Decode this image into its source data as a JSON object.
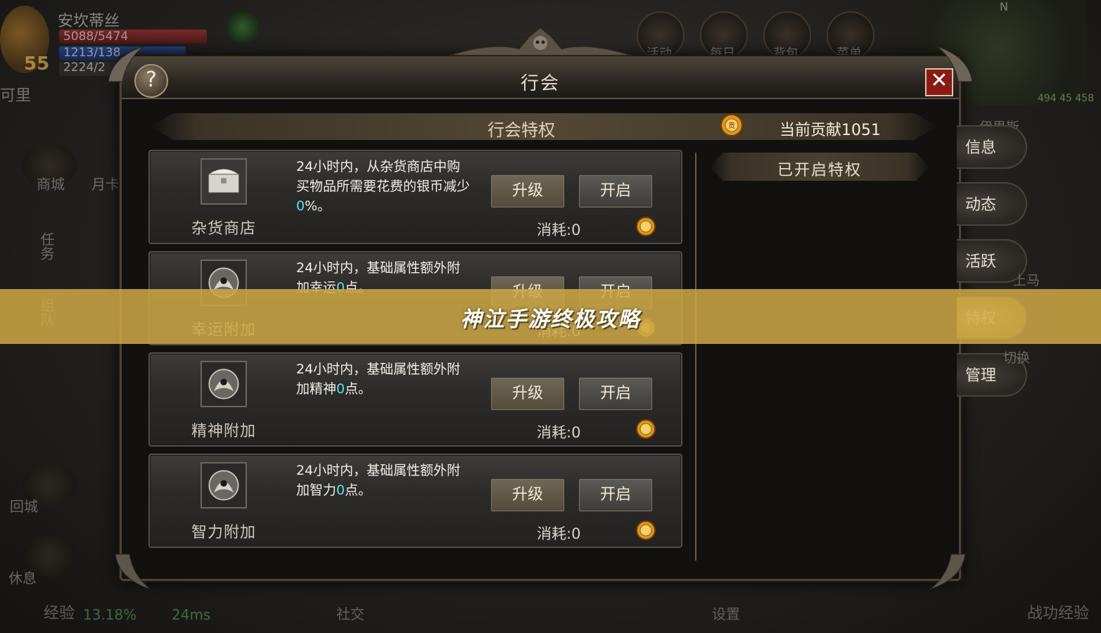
{
  "hud": {
    "player_name": "安坎蒂丝",
    "hp": "5088/5474",
    "mp": "1213/138",
    "xp": "2224/2",
    "level": "55",
    "left_hint": "可里",
    "top_icons": [
      "活动",
      "每日",
      "背包",
      "菜单"
    ],
    "left_buttons": [
      "商城",
      "月卡",
      "任务",
      "组队",
      "回城",
      "休息"
    ],
    "bottom_left": "经验",
    "exp_percent": "13.18%",
    "ping": "24ms",
    "bottom_social": "社交",
    "bottom_settings": "设置",
    "bottom_right": "战功经验",
    "compass": "N",
    "minimap_coords": "494 45 458",
    "side_faint_top": "伊思斯",
    "side_faint_mount": "上马",
    "side_faint_switch": "切换"
  },
  "window": {
    "title": "行会",
    "help_label": "?",
    "close_label": "✕",
    "banner_title": "行会特权",
    "contribution": "当前贡献1051",
    "right_header": "已开启特权"
  },
  "privileges": [
    {
      "name": "杂货商店",
      "icon": "chest-icon",
      "desc_before": "24小时内，从杂货商店中购买物品所需要花费的银币减少",
      "desc_value": "0",
      "desc_after": "%。",
      "upgrade_label": "升级",
      "open_label": "开启",
      "cost": "消耗:0"
    },
    {
      "name": "幸运附加",
      "icon": "luck-rune-icon",
      "desc_before": "24小时内，基础属性额外附加幸运",
      "desc_value": "0",
      "desc_after": "点。",
      "upgrade_label": "升级",
      "open_label": "开启",
      "cost": "消耗:0"
    },
    {
      "name": "精神附加",
      "icon": "spirit-rune-icon",
      "desc_before": "24小时内，基础属性额外附加精神",
      "desc_value": "0",
      "desc_after": "点。",
      "upgrade_label": "升级",
      "open_label": "开启",
      "cost": "消耗:0"
    },
    {
      "name": "智力附加",
      "icon": "intellect-rune-icon",
      "desc_before": "24小时内，基础属性额外附加智力",
      "desc_value": "0",
      "desc_after": "点。",
      "upgrade_label": "升级",
      "open_label": "开启",
      "cost": "消耗:0"
    }
  ],
  "side_tabs": [
    {
      "label": "信息",
      "active": false
    },
    {
      "label": "动态",
      "active": false
    },
    {
      "label": "活跃",
      "active": false
    },
    {
      "label": "特权",
      "active": true
    },
    {
      "label": "管理",
      "active": false
    }
  ],
  "overlay": {
    "text": "神泣手游终极攻略"
  },
  "colors": {
    "highlight_value": "#58e3e3",
    "overlay_band": "#cda846",
    "active_tab": "#c9a853"
  }
}
